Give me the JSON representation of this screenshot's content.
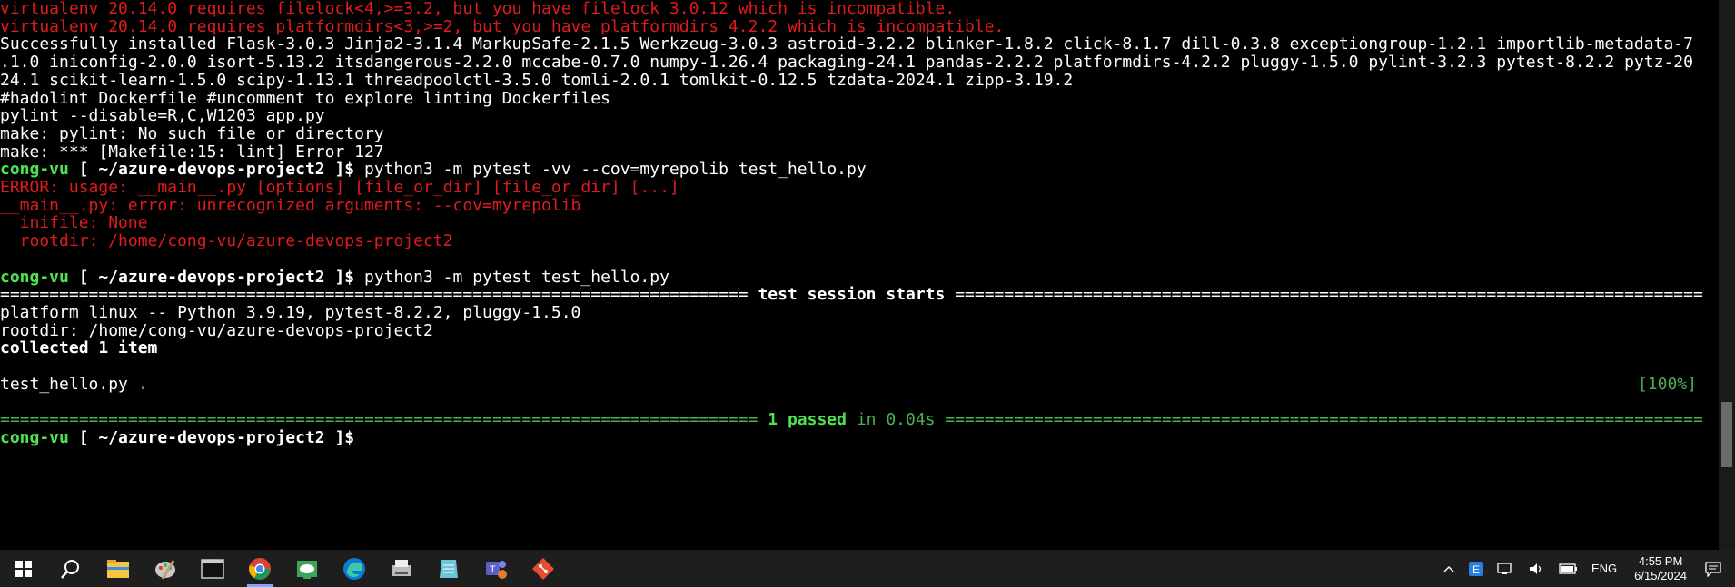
{
  "terminal": {
    "lines": [
      {
        "segs": [
          {
            "t": "virtualenv 20.14.0 requires filelock<4,>=3.2, but you have filelock 3.0.12 which is incompatible.",
            "c": "red"
          }
        ]
      },
      {
        "segs": [
          {
            "t": "virtualenv 20.14.0 requires platformdirs<3,>=2, but you have platformdirs 4.2.2 which is incompatible.",
            "c": "red"
          }
        ]
      },
      {
        "segs": [
          {
            "t": "Successfully installed Flask-3.0.3 Jinja2-3.1.4 MarkupSafe-2.1.5 Werkzeug-3.0.3 astroid-3.2.2 blinker-1.8.2 click-8.1.7 dill-0.3.8 exceptiongroup-1.2.1 importlib-metadata-7",
            "c": "white"
          }
        ]
      },
      {
        "segs": [
          {
            "t": ".1.0 iniconfig-2.0.0 isort-5.13.2 itsdangerous-2.2.0 mccabe-0.7.0 numpy-1.26.4 packaging-24.1 pandas-2.2.2 platformdirs-4.2.2 pluggy-1.5.0 pylint-3.2.3 pytest-8.2.2 pytz-20",
            "c": "white"
          }
        ]
      },
      {
        "segs": [
          {
            "t": "24.1 scikit-learn-1.5.0 scipy-1.13.1 threadpoolctl-3.5.0 tomli-2.0.1 tomlkit-0.12.5 tzdata-2024.1 zipp-3.19.2",
            "c": "white"
          }
        ]
      },
      {
        "segs": [
          {
            "t": "#hadolint Dockerfile #uncomment to explore linting Dockerfiles",
            "c": "white"
          }
        ]
      },
      {
        "segs": [
          {
            "t": "pylint --disable=R,C,W1203 app.py",
            "c": "white"
          }
        ]
      },
      {
        "segs": [
          {
            "t": "make: pylint: No such file or directory",
            "c": "white"
          }
        ]
      },
      {
        "segs": [
          {
            "t": "make: *** [Makefile:15: lint] Error 127",
            "c": "white"
          }
        ]
      },
      {
        "segs": [
          {
            "t": "cong-vu",
            "c": "green bold"
          },
          {
            "t": " [ ",
            "c": "white bold"
          },
          {
            "t": "~/azure-devops-project2",
            "c": "white bold"
          },
          {
            "t": " ]$ ",
            "c": "white bold"
          },
          {
            "t": "python3 -m pytest -vv --cov=myrepolib test_hello.py",
            "c": "white"
          }
        ]
      },
      {
        "segs": [
          {
            "t": "ERROR: usage: __main__.py [options] [file_or_dir] [file_or_dir] [...]",
            "c": "red"
          }
        ]
      },
      {
        "segs": [
          {
            "t": "__main__.py: error: unrecognized arguments: --cov=myrepolib",
            "c": "red"
          }
        ]
      },
      {
        "segs": [
          {
            "t": "  inifile: None",
            "c": "red"
          }
        ]
      },
      {
        "segs": [
          {
            "t": "  rootdir: /home/cong-vu/azure-devops-project2",
            "c": "red"
          }
        ]
      },
      {
        "segs": [
          {
            "t": "",
            "c": "white"
          }
        ]
      },
      {
        "segs": [
          {
            "t": "cong-vu",
            "c": "green bold"
          },
          {
            "t": " [ ",
            "c": "white bold"
          },
          {
            "t": "~/azure-devops-project2",
            "c": "white bold"
          },
          {
            "t": " ]$ ",
            "c": "white bold"
          },
          {
            "t": "python3 -m pytest test_hello.py",
            "c": "white"
          }
        ]
      },
      {
        "segs": [
          {
            "t": "============================================================================ ",
            "c": "white"
          },
          {
            "t": "test session starts",
            "c": "white bold"
          },
          {
            "t": " ============================================================================",
            "c": "white"
          }
        ]
      },
      {
        "segs": [
          {
            "t": "platform linux -- Python 3.9.19, pytest-8.2.2, pluggy-1.5.0",
            "c": "white"
          }
        ]
      },
      {
        "segs": [
          {
            "t": "rootdir: /home/cong-vu/azure-devops-project2",
            "c": "white"
          }
        ]
      },
      {
        "segs": [
          {
            "t": "collected 1 item",
            "c": "white bold"
          }
        ]
      },
      {
        "segs": [
          {
            "t": "",
            "c": "white"
          }
        ]
      },
      {
        "segs": [
          {
            "t": "test_hello.py ",
            "c": "white"
          },
          {
            "t": ".",
            "c": "green-dim"
          }
        ],
        "right": "[100%]"
      },
      {
        "segs": [
          {
            "t": "",
            "c": "white"
          }
        ]
      },
      {
        "segs": [
          {
            "t": "============================================================================= ",
            "c": "green-dim"
          },
          {
            "t": "1 passed",
            "c": "green bold"
          },
          {
            "t": " in 0.04s",
            "c": "green-dim"
          },
          {
            "t": " =============================================================================",
            "c": "green-dim"
          }
        ]
      },
      {
        "segs": [
          {
            "t": "cong-vu",
            "c": "green bold"
          },
          {
            "t": " [ ",
            "c": "white bold"
          },
          {
            "t": "~/azure-devops-project2",
            "c": "white bold"
          },
          {
            "t": " ]$ ",
            "c": "white bold"
          }
        ]
      }
    ]
  },
  "scrollbar": {
    "position": 0.83,
    "visible_fraction": 0.12
  },
  "taskbar": {
    "apps": [
      {
        "name": "windows-logo-icon",
        "active": false
      },
      {
        "name": "search-icon",
        "active": false
      },
      {
        "name": "file-explorer-icon",
        "active": false
      },
      {
        "name": "paint-brush-icon",
        "active": false
      },
      {
        "name": "terminal-icon",
        "active": false
      },
      {
        "name": "chrome-icon",
        "active": true
      },
      {
        "name": "cloud-app-icon",
        "active": false
      },
      {
        "name": "edge-icon",
        "active": false
      },
      {
        "name": "scanner-icon",
        "active": false
      },
      {
        "name": "notes-icon",
        "active": false
      },
      {
        "name": "teams-icon",
        "active": false
      },
      {
        "name": "git-icon",
        "active": false
      }
    ],
    "tray": {
      "language": "ENG",
      "time": "4:55 PM",
      "date": "6/15/2024"
    }
  }
}
